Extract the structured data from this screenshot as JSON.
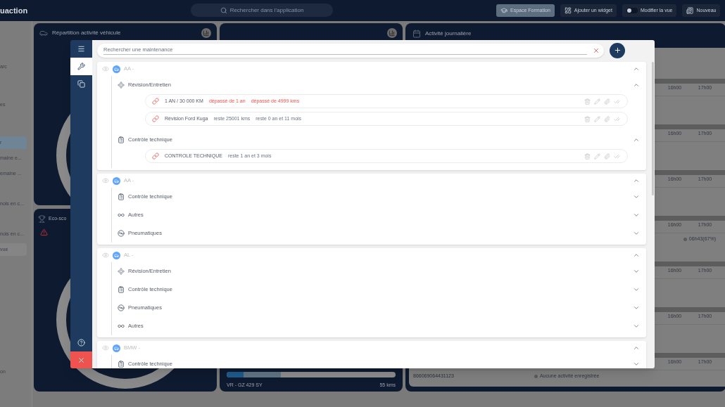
{
  "topbar": {
    "logo": "uaction",
    "search_placeholder": "Rechercher dans l'application",
    "actions": [
      {
        "kind": "training",
        "label": "Espace Formation",
        "selected": true
      },
      {
        "kind": "widget",
        "label": "Ajouter un widget",
        "selected": false
      },
      {
        "kind": "toggle",
        "label": "Modifier la vue",
        "selected": false,
        "on": false
      },
      {
        "kind": "new",
        "label": "Nouveau",
        "selected": false
      }
    ]
  },
  "sidebar": {
    "items": [
      {
        "label": "arc",
        "selected": false
      },
      {
        "label": "es",
        "selected": false
      },
      {
        "label": "r",
        "selected": true
      },
      {
        "label": "maine e...",
        "selected": false
      },
      {
        "label": "emaine ...",
        "selected": false
      },
      {
        "label": "nois en c...",
        "selected": false
      },
      {
        "label": "nois en c...",
        "selected": false
      },
      {
        "label": "vue",
        "selected": false,
        "kind": "button"
      },
      {
        "label": "on",
        "selected": false
      }
    ]
  },
  "widgets": {
    "vehicle_activity": {
      "title": "Répartition activité véhicule"
    },
    "eco_score": {
      "title": "Eco-sco",
      "warning": true
    },
    "mileage": {
      "plate": "VR - GZ 429 SY",
      "distance": "55 kms",
      "segments": [
        {
          "level": 0.1
        },
        {
          "level": 0.22
        }
      ]
    },
    "daily_activity": {
      "title": "Activité journalière",
      "rows": [
        {
          "ticks": [
            "16h00",
            "17h00"
          ]
        },
        {
          "ticks": [
            "16h00",
            "17h00"
          ]
        },
        {
          "ticks": [
            "16h00",
            "17h00"
          ]
        },
        {
          "ticks": [
            "16h00",
            "17h00"
          ],
          "status": "06h43(67%)",
          "kind": "duration"
        },
        {
          "ticks": [
            "16h00",
            "17h00"
          ]
        },
        {
          "ticks": [
            "16h00",
            "17h00"
          ]
        },
        {
          "ticks": [
            "16h00",
            "17h00"
          ],
          "device": "866069064431123",
          "status": "Aucune activité enregistrée",
          "kind": "empty"
        }
      ]
    }
  },
  "maintenance": {
    "search_placeholder": "Rechercher une maintenance",
    "nav": [
      {
        "kind": "menu",
        "selected": false
      },
      {
        "kind": "wrench",
        "selected": true
      },
      {
        "kind": "copy",
        "selected": false
      }
    ],
    "vehicles": [
      {
        "name": "AA -",
        "expanded": true,
        "categories": [
          {
            "kind": "revision",
            "label": "Révision/Entretien",
            "expanded": true,
            "items": [
              {
                "name": "1 AN / 30 000 KM",
                "details": [
                  {
                    "text": "dépassé de 1 an",
                    "overdue": true
                  },
                  {
                    "text": "dépassé de 4999 kms",
                    "overdue": true
                  }
                ]
              },
              {
                "name": "Révision Ford Kuga",
                "details": [
                  {
                    "text": "reste 25001 kms",
                    "overdue": false
                  },
                  {
                    "text": "reste 0 an et 11 mois",
                    "overdue": false
                  }
                ]
              }
            ]
          },
          {
            "kind": "controle",
            "label": "Contrôle technique",
            "expanded": true,
            "items": [
              {
                "name": "CONTROLE TECHNIQUE",
                "details": [
                  {
                    "text": "reste 1 an et 3 mois",
                    "overdue": false
                  }
                ]
              }
            ]
          }
        ]
      },
      {
        "name": "AA -",
        "expanded": true,
        "categories": [
          {
            "kind": "controle",
            "label": "Contrôle technique",
            "expanded": false
          },
          {
            "kind": "autres",
            "label": "Autres",
            "expanded": false
          },
          {
            "kind": "pneu",
            "label": "Pneumatiques",
            "expanded": false
          }
        ]
      },
      {
        "name": "AL -",
        "expanded": true,
        "categories": [
          {
            "kind": "revision",
            "label": "Révision/Entretien",
            "expanded": false
          },
          {
            "kind": "controle",
            "label": "Contrôle technique",
            "expanded": false
          },
          {
            "kind": "pneu",
            "label": "Pneumatiques",
            "expanded": false
          },
          {
            "kind": "autres",
            "label": "Autres",
            "expanded": false
          }
        ]
      },
      {
        "name": "BMW -",
        "expanded": true,
        "categories": [
          {
            "kind": "controle",
            "label": "Contrôle technique",
            "expanded": false
          }
        ]
      }
    ]
  }
}
